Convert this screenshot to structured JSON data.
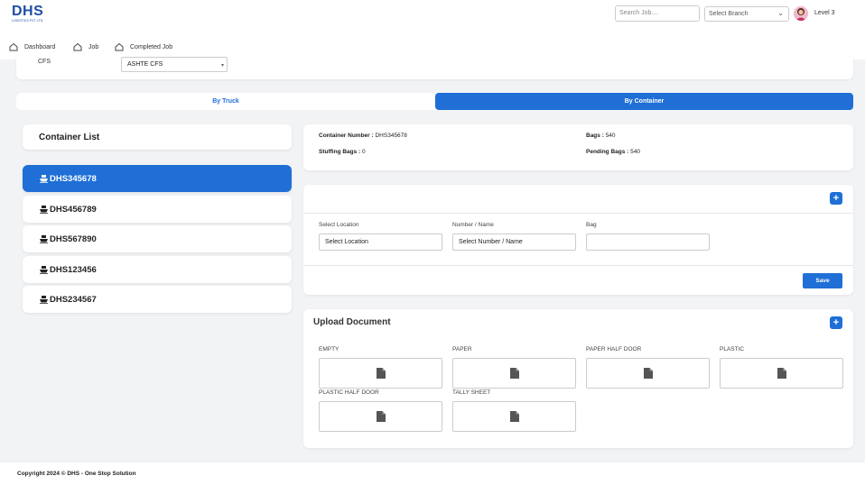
{
  "header": {
    "logo_main": "DHS",
    "logo_sub": "LOGISTICS PVT. LTD.",
    "search_placeholder": "Search Job....",
    "branch_select": "Select Branch",
    "user_level": "Level 3"
  },
  "nav": {
    "items": [
      {
        "label": "Dashboard",
        "icon": "home-icon"
      },
      {
        "label": "Job",
        "icon": "home-icon"
      },
      {
        "label": "Completed Job",
        "icon": "home-icon"
      }
    ]
  },
  "cfs": {
    "label": "CFS",
    "value": "ASHTE CFS"
  },
  "mode_toggle": {
    "truck_label": "By Truck",
    "container_label": "By Container",
    "active": "By Container"
  },
  "container_list": {
    "title": "Container List",
    "items": [
      "DHS345678",
      "DHS456789",
      "DHS567890",
      "DHS123456",
      "DHS234567"
    ],
    "active": "DHS345678"
  },
  "container_info": {
    "number_label": "Container Number :",
    "number_value": "DHS345678",
    "bags_label": "Bags :",
    "bags_value": "540",
    "stuffing_label": "Stuffing Bags :",
    "stuffing_value": "0",
    "pending_label": "Pending Bags :",
    "pending_value": "540"
  },
  "location_form": {
    "add_label": "+",
    "location_label": "Select Location",
    "location_value": "Select Location",
    "number_label": "Number / Name",
    "number_value": "Select Number / Name",
    "bag_label": "Bag",
    "bag_value": "",
    "save_label": "Save"
  },
  "upload": {
    "title": "Upload Document",
    "add_label": "+",
    "documents": [
      "EMPTY",
      "PAPER",
      "PAPER HALF DOOR",
      "PLASTIC",
      "PLASTIC HALF DOOR",
      "TALLY SHEET"
    ]
  },
  "footer": {
    "copyright": "Copyright 2024 © DHS - One Stop Solution"
  },
  "colors": {
    "primary": "#1f6fd6",
    "brand": "#1f4fa3",
    "background": "#f2f3f5"
  }
}
